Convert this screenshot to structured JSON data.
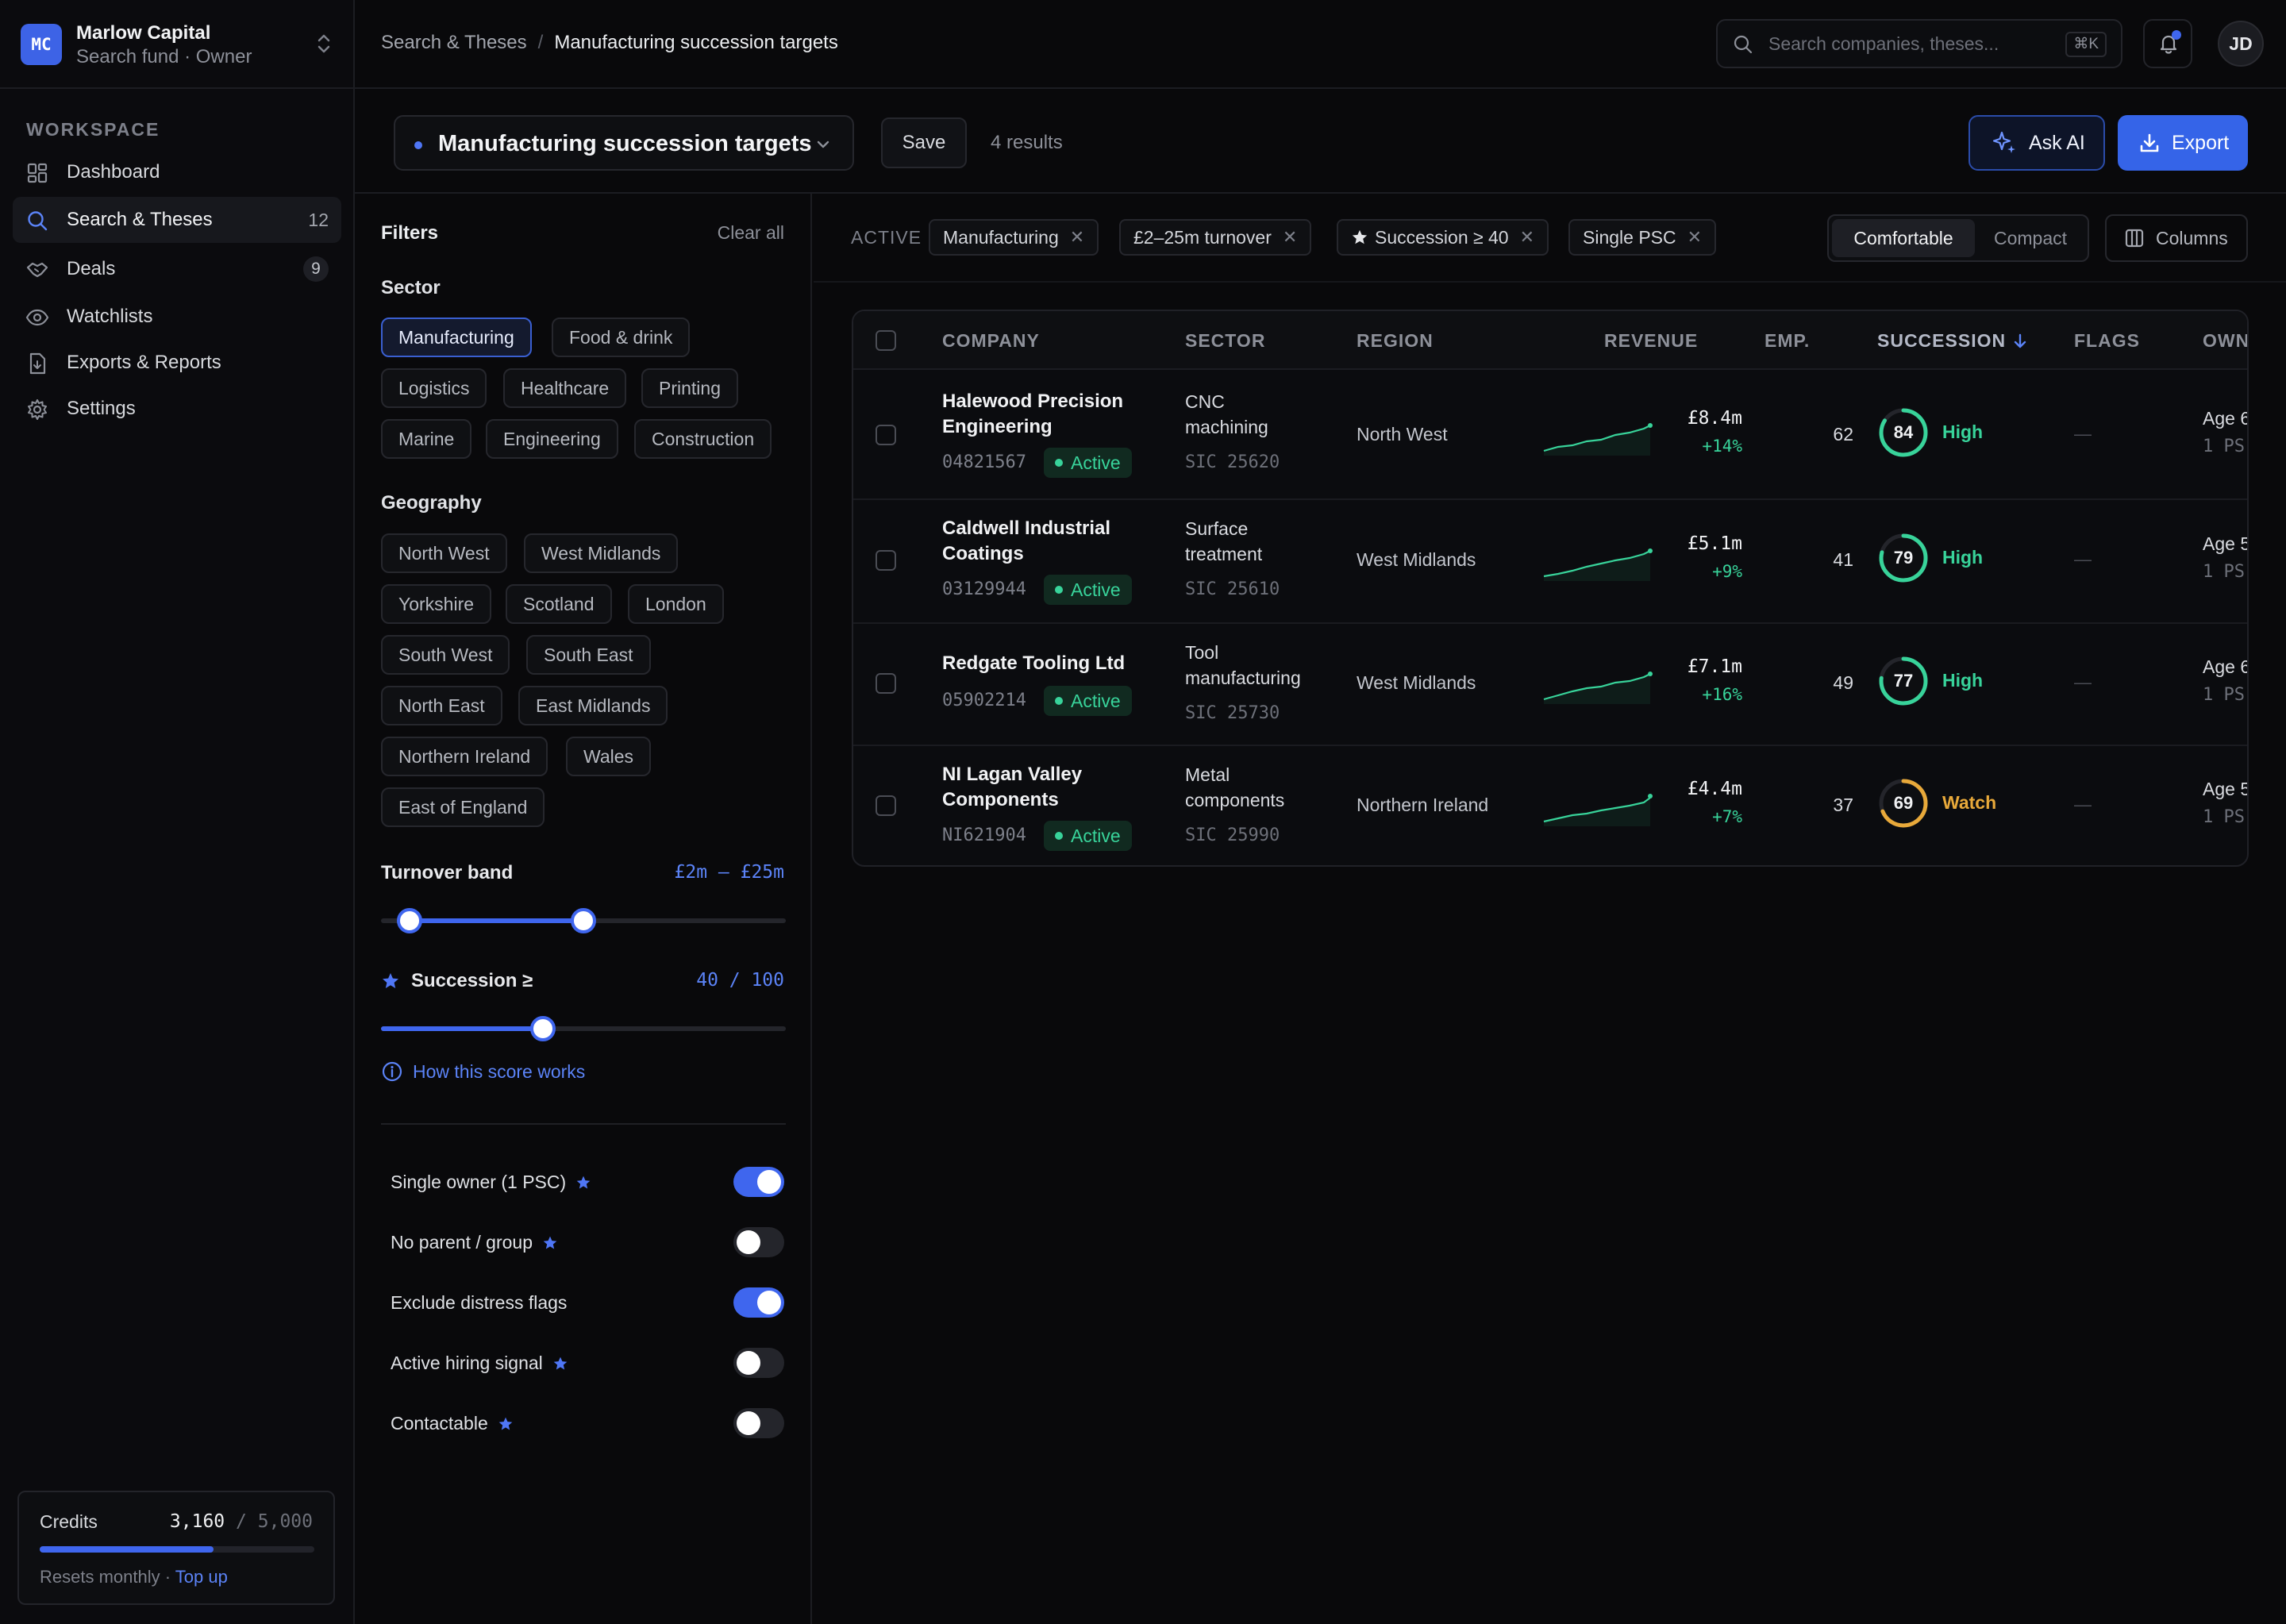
{
  "org": {
    "initials": "MC",
    "name": "Marlow Capital",
    "subtitle": "Search fund · Owner"
  },
  "sidebar": {
    "section_label": "WORKSPACE",
    "items": [
      {
        "label": "Dashboard",
        "icon": "dashboard-icon"
      },
      {
        "label": "Search & Theses",
        "icon": "search-icon",
        "count": "12",
        "active": true
      },
      {
        "label": "Deals",
        "icon": "handshake-icon",
        "badge": "9"
      },
      {
        "label": "Watchlists",
        "icon": "eye-icon"
      },
      {
        "label": "Exports & Reports",
        "icon": "file-icon"
      },
      {
        "label": "Settings",
        "icon": "gear-icon"
      }
    ],
    "credits": {
      "label": "Credits",
      "used": "3,160",
      "sep": "/",
      "total": "5,000",
      "progress_fraction": 0.632,
      "foot_text": "Resets monthly · ",
      "foot_link": "Top up"
    }
  },
  "topbar": {
    "breadcrumb": [
      "Search & Theses",
      "Manufacturing succession targets"
    ],
    "breadcrumb_sep": "/",
    "search_placeholder": "Search companies, theses...",
    "search_shortcut": "⌘K",
    "avatar_initials": "JD",
    "accent": "#3f66ee"
  },
  "header": {
    "view_title": "Manufacturing succession targets",
    "save_label": "Save",
    "results": "4 results",
    "ask_ai_label": "Ask AI",
    "export_label": "Export"
  },
  "filters": {
    "title": "Filters",
    "clear_label": "Clear all",
    "sector_label": "Sector",
    "sectors": [
      "Manufacturing",
      "Food & drink",
      "Logistics",
      "Healthcare",
      "Printing",
      "Marine",
      "Engineering",
      "Construction"
    ],
    "sector_selected": "Manufacturing",
    "geography_label": "Geography",
    "geographies": [
      "North West",
      "West Midlands",
      "Yorkshire",
      "Scotland",
      "London",
      "South West",
      "South East",
      "North East",
      "East Midlands",
      "Northern Ireland",
      "Wales",
      "East of England"
    ],
    "turnover": {
      "label": "Turnover band",
      "value": "£2m – £25m",
      "min_fraction": 0.07,
      "max_fraction": 0.5
    },
    "succession": {
      "label": "Succession ≥",
      "value": "40 / 100",
      "fraction": 0.4
    },
    "how_link": "How this score works",
    "toggles": [
      {
        "label": "Single owner (1 PSC)",
        "star": true,
        "on": true
      },
      {
        "label": "No parent / group",
        "star": true,
        "on": false
      },
      {
        "label": "Exclude distress flags",
        "star": false,
        "on": true
      },
      {
        "label": "Active hiring signal",
        "star": true,
        "on": false
      },
      {
        "label": "Contactable",
        "star": true,
        "on": false
      }
    ]
  },
  "active_filters": {
    "label": "ACTIVE",
    "chips": [
      "Manufacturing",
      "£2–25m turnover",
      "Succession ≥ 40",
      "Single PSC"
    ]
  },
  "density": {
    "options": [
      "Comfortable",
      "Compact"
    ],
    "selected": "Comfortable"
  },
  "columns_label": "Columns",
  "table": {
    "headers": [
      "COMPANY",
      "SECTOR",
      "REGION",
      "REVENUE",
      "EMP.",
      "SUCCESSION",
      "FLAGS",
      "OWN"
    ],
    "sort_column": "SUCCESSION",
    "rows": [
      {
        "name_lines": [
          "Halewood Precision",
          "Engineering"
        ],
        "number": "04821567",
        "status": "Active",
        "sector_lines": [
          "CNC",
          "machining"
        ],
        "sic": "SIC 25620",
        "region": "North West",
        "revenue": "£8.4m",
        "growth": "+14%",
        "employees": "62",
        "succession": 84,
        "level": "High",
        "flags": "—",
        "owner_age": "Age 6",
        "owner_psc": "1 PS"
      },
      {
        "name_lines": [
          "Caldwell Industrial",
          "Coatings"
        ],
        "number": "03129944",
        "status": "Active",
        "sector_lines": [
          "Surface",
          "treatment"
        ],
        "sic": "SIC 25610",
        "region": "West Midlands",
        "revenue": "£5.1m",
        "growth": "+9%",
        "employees": "41",
        "succession": 79,
        "level": "High",
        "flags": "—",
        "owner_age": "Age 5",
        "owner_psc": "1 PS"
      },
      {
        "name_lines": [
          "Redgate Tooling Ltd"
        ],
        "number": "05902214",
        "status": "Active",
        "sector_lines": [
          "Tool",
          "manufacturing"
        ],
        "sic": "SIC 25730",
        "region": "West Midlands",
        "revenue": "£7.1m",
        "growth": "+16%",
        "employees": "49",
        "succession": 77,
        "level": "High",
        "flags": "—",
        "owner_age": "Age 6",
        "owner_psc": "1 PS"
      },
      {
        "name_lines": [
          "NI Lagan Valley",
          "Components"
        ],
        "number": "NI621904",
        "status": "Active",
        "sector_lines": [
          "Metal",
          "components"
        ],
        "sic": "SIC 25990",
        "region": "Northern Ireland",
        "revenue": "£4.4m",
        "growth": "+7%",
        "employees": "37",
        "succession": 69,
        "level": "Watch",
        "flags": "—",
        "owner_age": "Age 5",
        "owner_psc": "1 PS"
      }
    ],
    "colors": {
      "high": "#38d39a",
      "watch": "#e8a93a"
    }
  }
}
